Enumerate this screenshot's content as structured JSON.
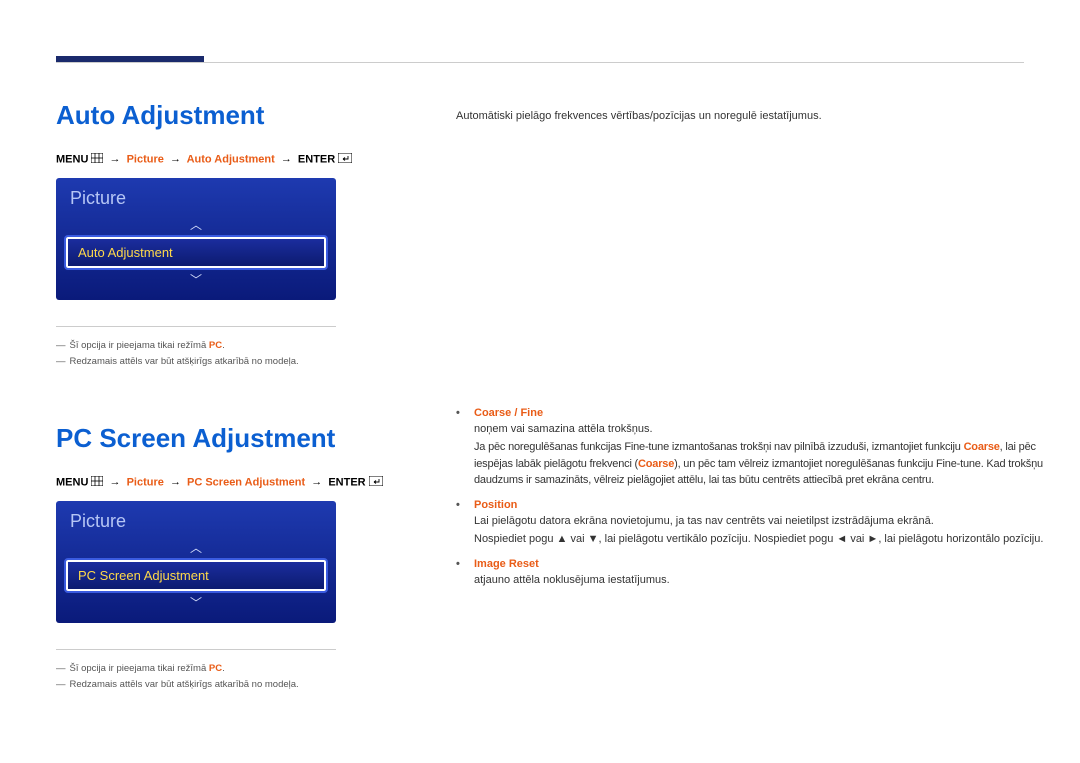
{
  "section1": {
    "heading": "Auto Adjustment",
    "breadcrumb": {
      "menu": "MENU",
      "picture": "Picture",
      "item": "Auto Adjustment",
      "enter": "ENTER"
    },
    "panel": {
      "title": "Picture",
      "selected": "Auto Adjustment"
    },
    "notes": {
      "n1_prefix": "Šī opcija ir pieejama tikai režīmā ",
      "n1_pc": "PC",
      "n2": "Redzamais attēls var būt atšķirīgs atkarībā no modeļa."
    },
    "desc": "Automātiski pielāgo frekvences vērtības/pozīcijas un noregulē iestatījumus."
  },
  "section2": {
    "heading": "PC Screen Adjustment",
    "breadcrumb": {
      "menu": "MENU",
      "picture": "Picture",
      "item": "PC Screen Adjustment",
      "enter": "ENTER"
    },
    "panel": {
      "title": "Picture",
      "selected": "PC Screen Adjustment"
    },
    "notes": {
      "n1_prefix": "Šī opcija ir pieejama tikai režīmā ",
      "n1_pc": "PC",
      "n2": "Redzamais attēls var būt atšķirīgs atkarībā no modeļa."
    },
    "bullets": {
      "b1": {
        "title": "Coarse / Fine",
        "line1": "noņem vai samazina attēla trokšņus.",
        "line2a": "Ja pēc noregulēšanas funkcijas Fine-tune izmantošanas trokšņi nav pilnībā izzuduši, izmantojiet funkciju ",
        "coarse1": "Coarse",
        "line2b": ", lai pēc iespējas labāk pielāgotu frekvenci (",
        "coarse2": "Coarse",
        "line2c": "), un pēc tam vēlreiz izmantojiet noregulēšanas funkciju Fine-tune. Kad trokšņu daudzums ir samazināts, vēlreiz pielāgojiet attēlu, lai tas būtu centrēts attiecībā pret ekrāna centru."
      },
      "b2": {
        "title": "Position",
        "line1": "Lai pielāgotu datora ekrāna novietojumu, ja tas nav centrēts vai neietilpst izstrādājuma ekrānā.",
        "line2a": "Nospiediet pogu ▲ vai ▼, lai pielāgotu vertikālo pozīciju. Nospiediet pogu ◄ vai ►, lai pielāgotu horizontālo pozīciju."
      },
      "b3": {
        "title": "Image Reset",
        "line1": "atjauno attēla noklusējuma iestatījumus."
      }
    }
  }
}
